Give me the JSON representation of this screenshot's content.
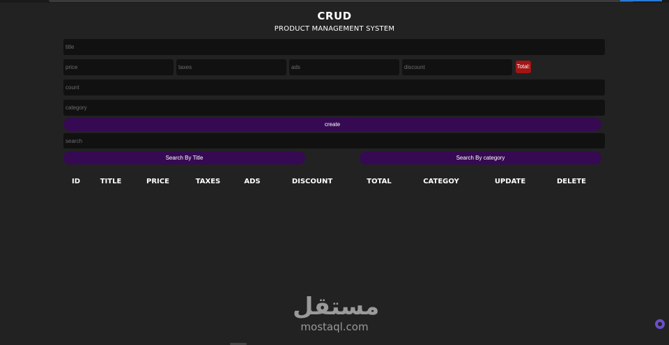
{
  "header": {
    "title": "CRUD",
    "subtitle": "PRODUCT MANAGEMENT SYSTEM"
  },
  "form": {
    "title_placeholder": "title",
    "price_placeholder": "price",
    "taxes_placeholder": "taxes",
    "ads_placeholder": "ads",
    "discount_placeholder": "discount",
    "total_label": "Total:",
    "count_placeholder": "count",
    "category_placeholder": "category",
    "create_label": "create"
  },
  "search": {
    "placeholder": "search",
    "by_title_label": "Search By Title",
    "by_category_label": "Search By category"
  },
  "table": {
    "headers": [
      "ID",
      "TITLE",
      "PRICE",
      "TAXES",
      "ADS",
      "DISCOUNT",
      "TOTAL",
      "CATEGOY",
      "UPDATE",
      "DELETE"
    ]
  },
  "watermark": {
    "arabic": "مستقل",
    "latin": "mostaql.com"
  },
  "colors": {
    "background": "#222222",
    "input": "#111111",
    "button": "#360a52",
    "total_badge": "#a31515"
  }
}
